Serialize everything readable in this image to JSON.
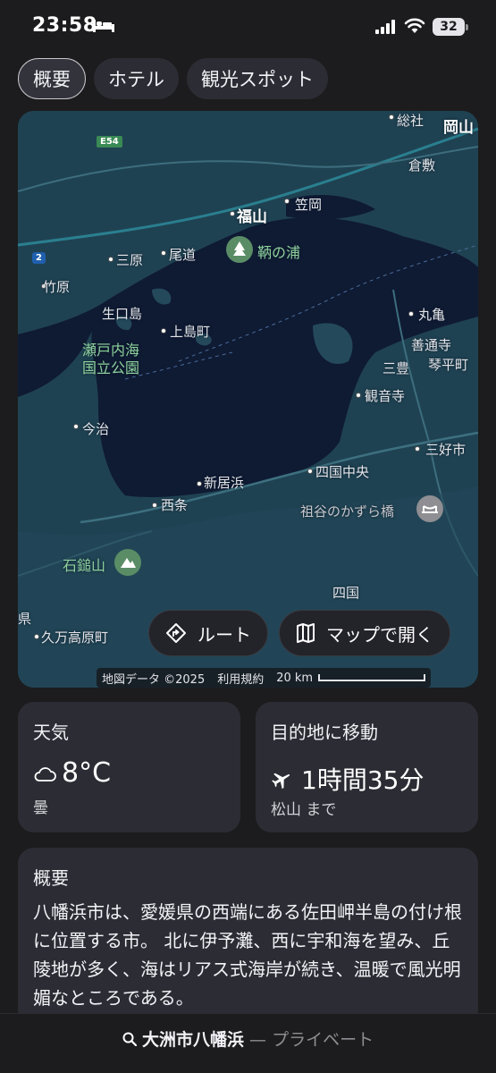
{
  "status": {
    "time": "23:58",
    "battery": "32"
  },
  "tabs": [
    {
      "label": "概要"
    },
    {
      "label": "ホテル"
    },
    {
      "label": "観光スポット"
    }
  ],
  "map": {
    "labels": {
      "okayama": "岡山",
      "soja": "総社",
      "kurashiki": "倉敷",
      "kasaoka": "笠岡",
      "fukuyama": "福山",
      "onomichi": "尾道",
      "mihara": "三原",
      "tomonoura": "鞆の浦",
      "takehara": "竹原",
      "ikuchijima": "生口島",
      "kamijima": "上島町",
      "setonaikai_park_1": "瀬戸内海",
      "setonaikai_park_2": "国立公園",
      "marugame": "丸亀",
      "zentsuji": "善通寺",
      "kotohira": "琴平町",
      "mitoyo": "三豊",
      "kanonji": "観音寺",
      "imabari": "今治",
      "miyoshi": "三好市",
      "niihama": "新居浜",
      "shikokuchuo": "四国中央",
      "saijo": "西条",
      "iya": "祖谷のかずら橋",
      "ishizuchi": "石鎚山",
      "shikoku": "四国",
      "kumakogen": "久万高原町",
      "ken": "県",
      "highway_e54": "E54",
      "route_2": "2"
    },
    "route_button": "ルート",
    "open_maps_button": "マップで開く",
    "attribution": "地図データ ©2025",
    "terms": "利用規約",
    "scale": "20 km"
  },
  "weather": {
    "title": "天気",
    "temperature": "8°C",
    "condition": "曇"
  },
  "travel": {
    "title": "目的地に移動",
    "duration": "1時間35分",
    "from": "松山 まで"
  },
  "overview": {
    "title": "概要",
    "text": "八幡浜市は、愛媛県の西端にある佐田岬半島の付け根に位置する市。 北に伊予灘、西に宇和海を望み、丘陵地が多く、海はリアス式海岸が続き、温暖で風光明媚なところである。"
  },
  "bottom": {
    "place": "大洲市八幡浜",
    "separator": " — ",
    "privacy": "プライベート"
  },
  "colors": {
    "background": "#1c1c1e",
    "card": "#2c2c34",
    "sea": "#0f1a33",
    "land": "#1f4252",
    "park_green": "#8fd19e"
  }
}
